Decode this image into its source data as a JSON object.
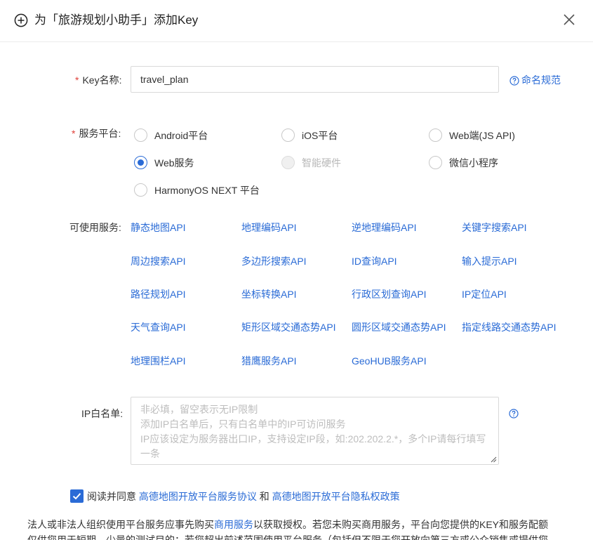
{
  "dialog": {
    "title": "为「旅游规划小助手」添加Key"
  },
  "key_name": {
    "required_mark": "*",
    "label": "Key名称:",
    "value": "travel_plan",
    "help": "命名规范"
  },
  "platform": {
    "required_mark": "*",
    "label": "服务平台:",
    "options": [
      {
        "label": "Android平台",
        "state": "unchecked"
      },
      {
        "label": "iOS平台",
        "state": "unchecked"
      },
      {
        "label": "Web端(JS API)",
        "state": "unchecked"
      },
      {
        "label": "Web服务",
        "state": "checked"
      },
      {
        "label": "智能硬件",
        "state": "disabled"
      },
      {
        "label": "微信小程序",
        "state": "unchecked"
      },
      {
        "label": "HarmonyOS NEXT 平台",
        "state": "unchecked"
      }
    ]
  },
  "services": {
    "label": "可使用服务:",
    "items": [
      "静态地图API",
      "地理编码API",
      "逆地理编码API",
      "关键字搜索API",
      "周边搜索API",
      "多边形搜索API",
      "ID查询API",
      "输入提示API",
      "路径规划API",
      "坐标转换API",
      "行政区划查询API",
      "IP定位API",
      "天气查询API",
      "矩形区域交通态势API",
      "圆形区域交通态势API",
      "指定线路交通态势API",
      "地理围栏API",
      "猎鹰服务API",
      "GeoHUB服务API"
    ]
  },
  "ip_whitelist": {
    "label": "IP白名单:",
    "placeholder_lines": [
      "非必填，留空表示无IP限制",
      "添加IP白名单后，只有白名单中的IP可访问服务",
      "IP应该设定为服务器出口IP，支持设定IP段，如:202.202.2.*，多个IP请每行填写",
      "一条"
    ]
  },
  "agreement": {
    "checked": true,
    "prefix": "阅读并同意",
    "link1": "高德地图开放平台服务协议",
    "and": "和",
    "link2": "高德地图开放平台隐私权政策"
  },
  "legal": {
    "line1_a": "法人或非法人组织使用平台服务应事先购买",
    "line1_link": "商用服务",
    "line1_b": "以获取授权。若您未购买商用服务，平台向您提供的KEY和服务配额",
    "line2": "仅供您用于短期、少量的测试目的；若您超出前述范围使用平台服务（包括但不限于您开放向第三方或公众销售或提供您"
  },
  "colors": {
    "accent": "#2a6bd6",
    "required": "#e0413a",
    "placeholder": "#bdbdbd"
  }
}
